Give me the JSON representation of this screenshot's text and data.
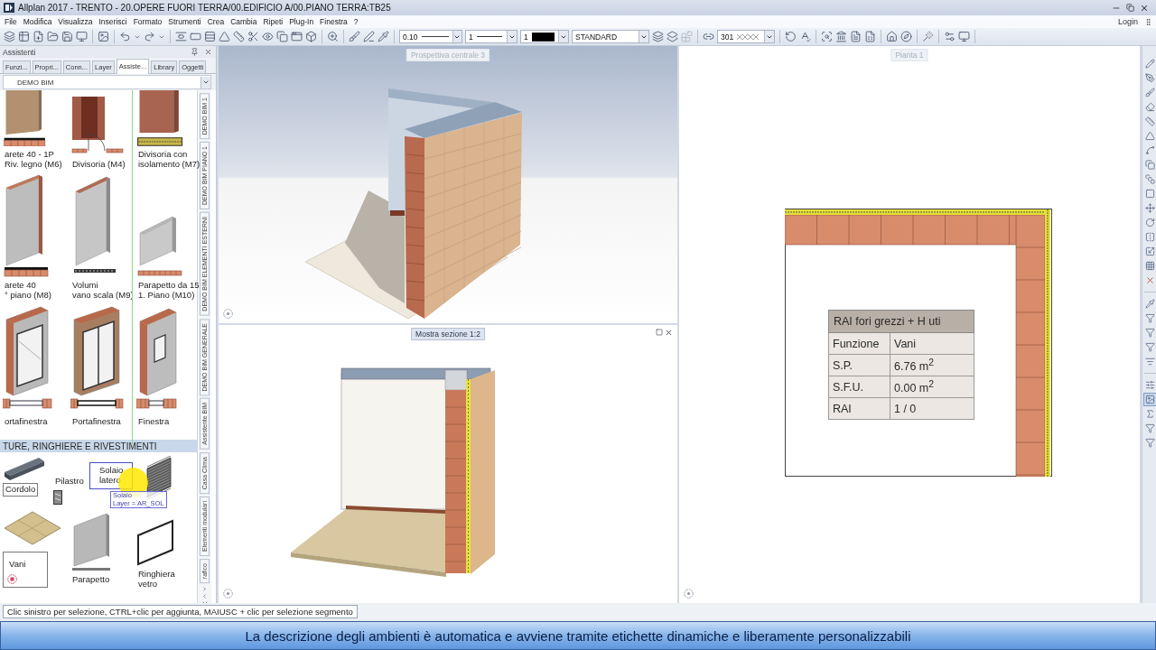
{
  "window": {
    "title": "Allplan 2017 - TRENTO - 20.OPERE FUORI TERRA/00.EDIFICIO A/00.PIANO TERRA:TB25"
  },
  "menu": [
    "File",
    "Modifica",
    "Visualizza",
    "Inserisci",
    "Formato",
    "Strumenti",
    "Crea",
    "Cambia",
    "Ripeti",
    "Plug-In",
    "Finestra",
    "?"
  ],
  "login": "Login",
  "toolbar": {
    "pen_thickness": "0.10",
    "line_type": "1",
    "pen_color": "1",
    "format_style": "STANDARD",
    "hatch_style": "301"
  },
  "panel": {
    "title": "Assistenti",
    "tabs": [
      {
        "label": "Funzi...",
        "selected": false
      },
      {
        "label": "Propri...",
        "selected": false
      },
      {
        "label": "Conn...",
        "selected": false
      },
      {
        "label": "Layer",
        "selected": false
      },
      {
        "label": "Assiste...",
        "selected": true
      },
      {
        "label": "Library",
        "selected": false
      },
      {
        "label": "Oggetti",
        "selected": false
      }
    ],
    "category": "DEMO BIM",
    "rows": [
      [
        {
          "kind": "woodwall",
          "label": "arete 40 - 1P\nRiv. legno (M6)",
          "selected": false
        },
        {
          "kind": "door",
          "label": "Divisoria (M4)",
          "selected": false
        },
        {
          "kind": "insulatedwall",
          "label": "Divisoria con\nisolamento (M7)",
          "selected": false
        }
      ],
      [
        {
          "kind": "wall",
          "label": "arete 40\n° piano (M8)",
          "selected": false
        },
        {
          "kind": "panel",
          "label": "Volumi\nvano scala (M9)",
          "selected": false
        },
        {
          "kind": "parapet",
          "label": "Parapetto da 15\n1. Piano (M10)",
          "selected": false
        }
      ],
      [
        {
          "kind": "frenchwindow",
          "label": "ortafinestra",
          "selected": false
        },
        {
          "kind": "slidingdoor",
          "label": "Portafinestra",
          "selected": false
        },
        {
          "kind": "window",
          "label": "Finestra",
          "selected": false
        }
      ]
    ],
    "section": {
      "title": "TURE, RINGHIERE E RIVESTIMENTI",
      "items": [
        {
          "kind": "beam",
          "label": "Cordolo",
          "selected": false
        },
        {
          "kind": "column",
          "label": "Pilastro",
          "selected": false
        },
        {
          "kind": "slab",
          "label": "Solaio\nlatero",
          "selected": true
        },
        {
          "kind": "railing",
          "selected": false
        },
        {
          "kind": "room",
          "label": "Vani",
          "selected": false
        },
        {
          "kind": "lowwall",
          "label": "Parapetto",
          "selected": false
        },
        {
          "kind": "glassrailing",
          "label": "Ringhiera\nvetro",
          "selected": false
        }
      ]
    },
    "tooltip": {
      "title": "Solaio",
      "detail": "Layer = AR_SOL"
    },
    "side_tabs": [
      {
        "label": "DEMO BIM 1",
        "selected": false
      },
      {
        "label": "DEMO BIM PIANO 1",
        "selected": false
      },
      {
        "label": "DEMO BIM ELEMENTI ESTERNI",
        "selected": false
      },
      {
        "label": "DEMO BIM GENERALE",
        "selected": false
      },
      {
        "label": "Assistente BIM",
        "selected": false
      },
      {
        "label": "Casa Clima",
        "selected": false
      },
      {
        "label": "Elementi modulari",
        "selected": false
      },
      {
        "label": "rafico",
        "selected": false
      }
    ]
  },
  "views": [
    {
      "title": "Prospettiva centrale 3",
      "active": false
    },
    {
      "title": "Mostra sezione 1:2",
      "active": true
    },
    {
      "title": "Pianta 1",
      "active": false
    }
  ],
  "room_stamp": {
    "title": "RAI fori grezzi + H uti",
    "rows": [
      {
        "label": "Funzione",
        "value": "Vani"
      },
      {
        "label": "S.P.",
        "value": "6.76 m$^{2}$"
      },
      {
        "label": "S.F.U.",
        "value": "0.00 m$^{2}$"
      },
      {
        "label": "RAI",
        "value": "1 / 0"
      }
    ]
  },
  "right_toolbar": [
    {
      "selected": false
    },
    {
      "selected": false
    },
    {
      "selected": false
    },
    {
      "selected": false
    },
    {
      "selected": false
    },
    {
      "selected": false
    },
    {
      "selected": false
    },
    {
      "selected": false
    },
    {
      "selected": false
    },
    {
      "selected": false
    },
    {
      "selected": false
    },
    {
      "selected": false
    },
    {
      "selected": false
    },
    {
      "selected": false
    },
    {
      "selected": false
    },
    {
      "selected": false
    },
    {
      "selected": false
    },
    {
      "selected": false
    },
    {
      "selected": false
    },
    {
      "selected": false
    },
    {
      "selected": false
    },
    {
      "selected": false
    },
    {
      "selected": true
    },
    {
      "selected": false
    },
    {
      "selected": false
    },
    {
      "selected": false
    }
  ],
  "status": "Clic sinistro per selezione, CTRL+clic per aggiunta, MAIUSC + clic per selezione segmento",
  "caption": "La descrizione degli ambienti è automatica e avviene tramite etichette dinamiche e liberamente personalizzabili"
}
